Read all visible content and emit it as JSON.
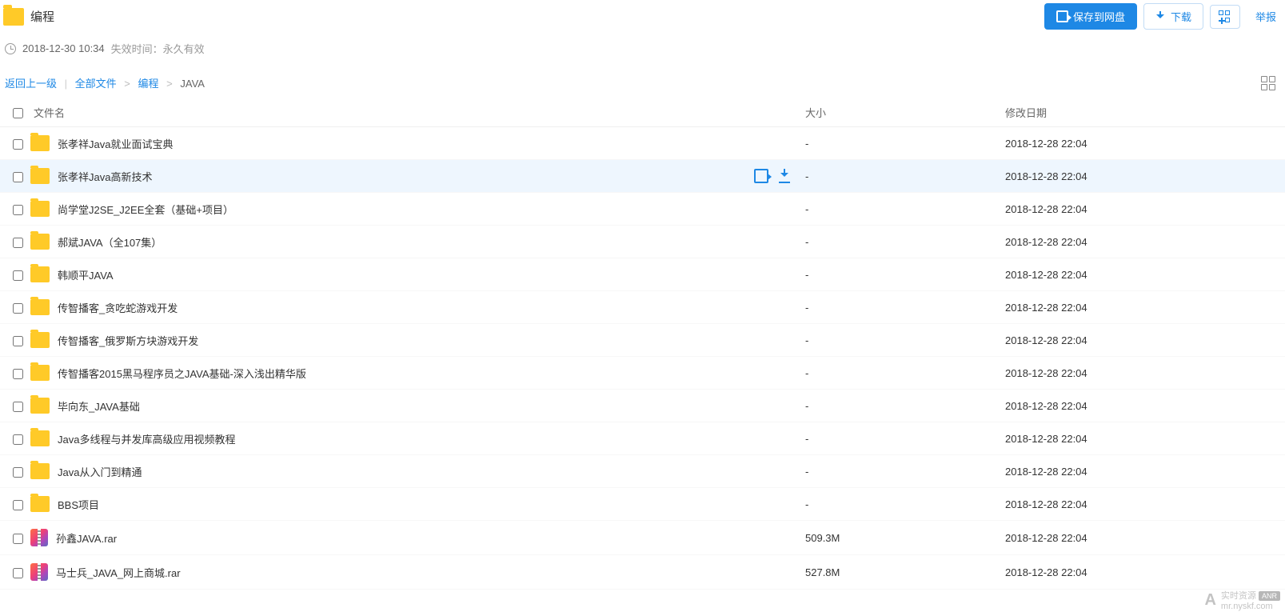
{
  "header": {
    "title": "编程",
    "btn_save": "保存到网盘",
    "btn_download": "下载",
    "btn_report": "举报"
  },
  "meta": {
    "share_time": "2018-12-30 10:34",
    "expire_label": "失效时间：",
    "expire_value": "永久有效"
  },
  "breadcrumb": {
    "back": "返回上一级",
    "all_files": "全部文件",
    "parent": "编程",
    "current": "JAVA"
  },
  "table": {
    "col_name": "文件名",
    "col_size": "大小",
    "col_date": "修改日期"
  },
  "rows": [
    {
      "type": "folder",
      "name": "张孝祥Java就业面试宝典",
      "size": "-",
      "date": "2018-12-28 22:04",
      "hovered": false
    },
    {
      "type": "folder",
      "name": "张孝祥Java高新技术",
      "size": "-",
      "date": "2018-12-28 22:04",
      "hovered": true
    },
    {
      "type": "folder",
      "name": "尚学堂J2SE_J2EE全套（基础+项目）",
      "size": "-",
      "date": "2018-12-28 22:04",
      "hovered": false
    },
    {
      "type": "folder",
      "name": "郝斌JAVA（全107集）",
      "size": "-",
      "date": "2018-12-28 22:04",
      "hovered": false
    },
    {
      "type": "folder",
      "name": "韩顺平JAVA",
      "size": "-",
      "date": "2018-12-28 22:04",
      "hovered": false
    },
    {
      "type": "folder",
      "name": "传智播客_贪吃蛇游戏开发",
      "size": "-",
      "date": "2018-12-28 22:04",
      "hovered": false
    },
    {
      "type": "folder",
      "name": "传智播客_俄罗斯方块游戏开发",
      "size": "-",
      "date": "2018-12-28 22:04",
      "hovered": false
    },
    {
      "type": "folder",
      "name": "传智播客2015黑马程序员之JAVA基础-深入浅出精华版",
      "size": "-",
      "date": "2018-12-28 22:04",
      "hovered": false
    },
    {
      "type": "folder",
      "name": "毕向东_JAVA基础",
      "size": "-",
      "date": "2018-12-28 22:04",
      "hovered": false
    },
    {
      "type": "folder",
      "name": "Java多线程与并发库高级应用视频教程",
      "size": "-",
      "date": "2018-12-28 22:04",
      "hovered": false
    },
    {
      "type": "folder",
      "name": "Java从入门到精通",
      "size": "-",
      "date": "2018-12-28 22:04",
      "hovered": false
    },
    {
      "type": "folder",
      "name": "BBS项目",
      "size": "-",
      "date": "2018-12-28 22:04",
      "hovered": false
    },
    {
      "type": "rar",
      "name": "孙鑫JAVA.rar",
      "size": "509.3M",
      "date": "2018-12-28 22:04",
      "hovered": false
    },
    {
      "type": "rar",
      "name": "马士兵_JAVA_网上商城.rar",
      "size": "527.8M",
      "date": "2018-12-28 22:04",
      "hovered": false
    }
  ],
  "watermark": {
    "text1": "实时资源",
    "text2": "mr.nyskf.com",
    "tag": "ANR"
  }
}
